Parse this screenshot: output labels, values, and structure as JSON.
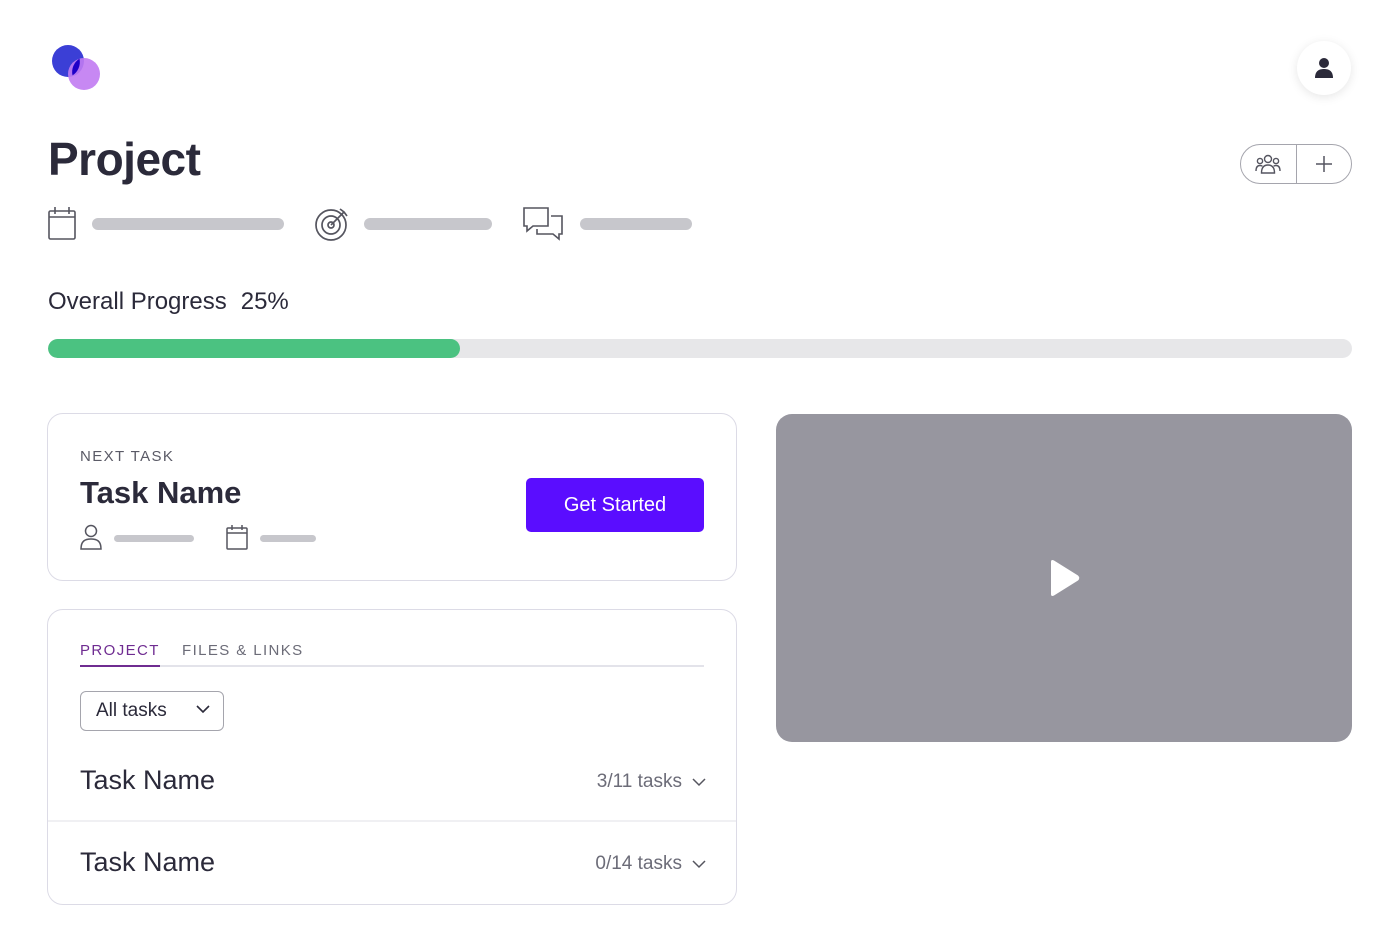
{
  "app": {
    "logo": "overlapping-circles-logo",
    "brand_colors": [
      "#3b3fd6",
      "#c17bf2"
    ]
  },
  "header": {
    "avatar_icon": "user-icon"
  },
  "project": {
    "title": "Project",
    "actions": {
      "team_icon": "users-icon",
      "add_icon": "plus-icon"
    },
    "meta": [
      {
        "icon": "calendar-icon"
      },
      {
        "icon": "target-icon"
      },
      {
        "icon": "chat-icon"
      }
    ]
  },
  "progress": {
    "label": "Overall Progress",
    "percent_text": "25%",
    "value": 0.25,
    "color": "#4bc281"
  },
  "next_task": {
    "label": "NEXT TASK",
    "title": "Task Name",
    "button_label": "Get Started",
    "button_color": "#5a0dff",
    "assignee_icon": "user-outline-icon",
    "due_icon": "calendar-icon"
  },
  "tasks_panel": {
    "tabs": [
      {
        "label": "PROJECT",
        "active": true
      },
      {
        "label": "FILES & LINKS",
        "active": false
      }
    ],
    "filter": {
      "selected": "All tasks"
    },
    "rows": [
      {
        "name": "Task Name",
        "count": "3/11 tasks"
      },
      {
        "name": "Task Name",
        "count": "0/14 tasks"
      }
    ]
  },
  "video": {
    "icon": "play-icon",
    "background": "#97969f"
  }
}
